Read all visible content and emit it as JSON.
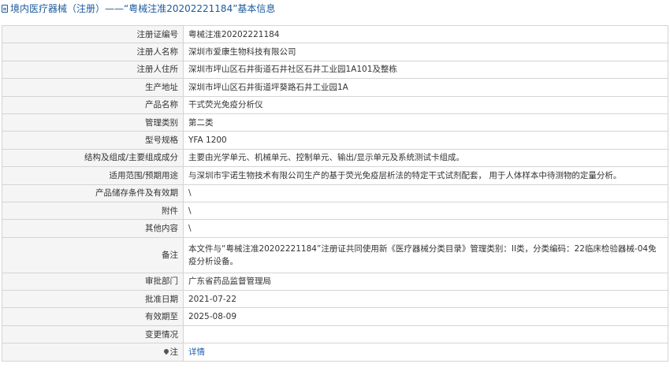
{
  "header": {
    "title": "境内医疗器械（注册）——“粤械注准20202221184”基本信息"
  },
  "rows": [
    {
      "label": "注册证编号",
      "value": "粤械注准20202221184"
    },
    {
      "label": "注册人名称",
      "value": "深圳市爱康生物科技有限公司"
    },
    {
      "label": "注册人住所",
      "value": "深圳市坪山区石井街道石井社区石井工业园1A101及整栋"
    },
    {
      "label": "生产地址",
      "value": "深圳市坪山区石井街道坪葵路石井工业园1A"
    },
    {
      "label": "产品名称",
      "value": "干式荧光免疫分析仪"
    },
    {
      "label": "管理类别",
      "value": "第二类"
    },
    {
      "label": "型号规格",
      "value": "YFA 1200"
    },
    {
      "label": "结构及组成/主要组成成分",
      "value": "主要由光学单元、机械单元、控制单元、输出/显示单元及系统测试卡组成。"
    },
    {
      "label": "适用范围/预期用途",
      "value": "与深圳市宇诺生物技术有限公司生产的基于荧光免疫层析法的特定干式试剂配套， 用于人体样本中待测物的定量分析。"
    },
    {
      "label": "产品储存条件及有效期",
      "value": "\\"
    },
    {
      "label": "附件",
      "value": "\\"
    },
    {
      "label": "其他内容",
      "value": "\\"
    },
    {
      "label": "备注",
      "value": "本文件与“粤械注准20202221184”注册证共同使用新《医疗器械分类目录》管理类别：II类，分类编码：22临床检验器械-04免疫分析设备。"
    },
    {
      "label": "审批部门",
      "value": "广东省药品监督管理局"
    },
    {
      "label": "批准日期",
      "value": "2021-07-22"
    },
    {
      "label": "有效期至",
      "value": "2025-08-09"
    },
    {
      "label": "变更情况",
      "value": ""
    }
  ],
  "note_row": {
    "label": "注",
    "link_text": "详情"
  }
}
